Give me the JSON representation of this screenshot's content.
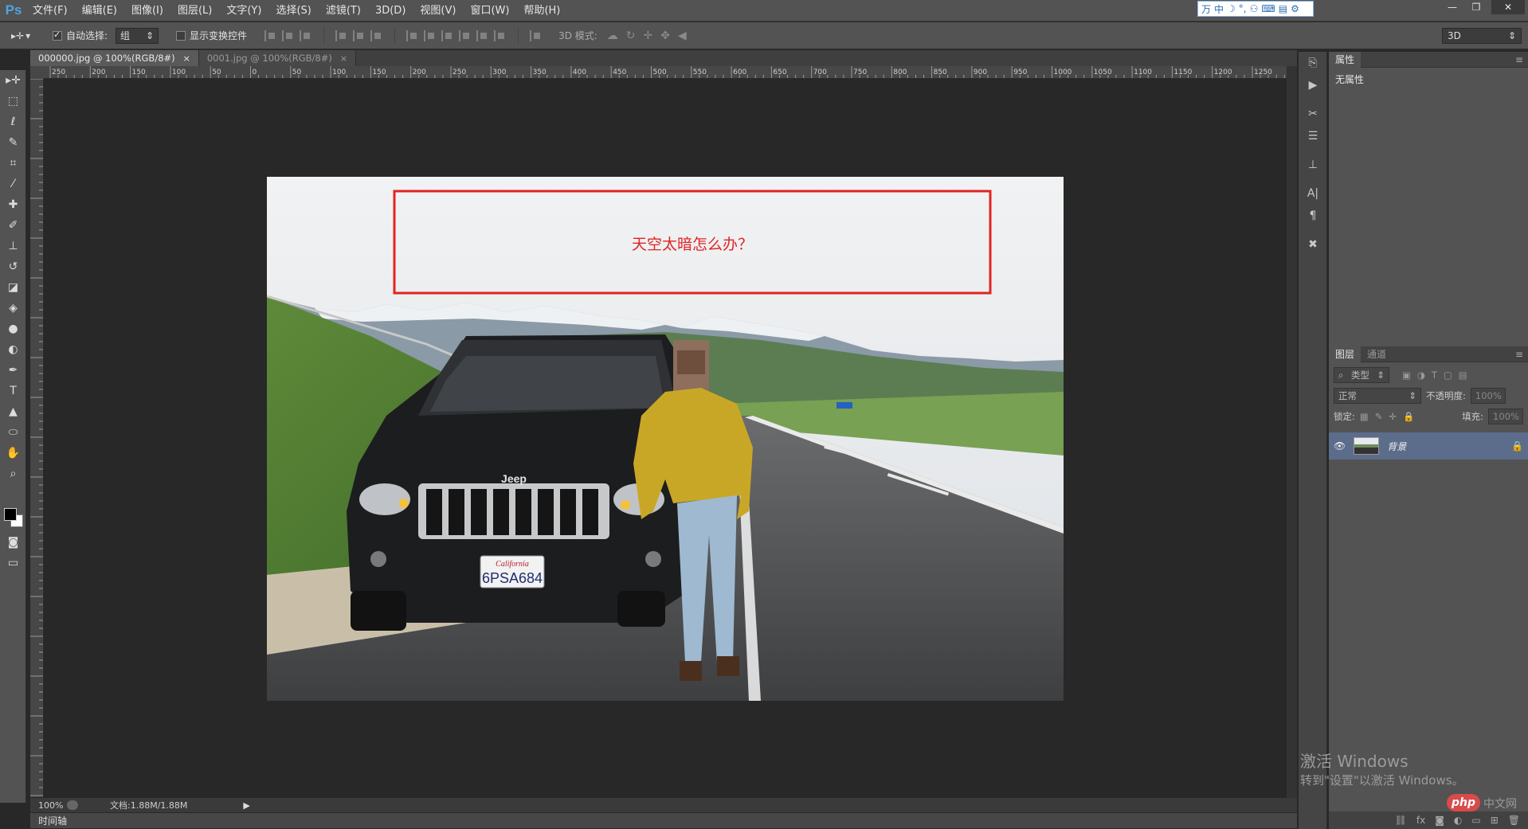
{
  "app": {
    "logo": "Ps"
  },
  "menu": [
    "文件(F)",
    "编辑(E)",
    "图像(I)",
    "图层(L)",
    "文字(Y)",
    "选择(S)",
    "滤镜(T)",
    "3D(D)",
    "视图(V)",
    "窗口(W)",
    "帮助(H)"
  ],
  "ime": {
    "label": "中"
  },
  "options": {
    "auto_select_label": "自动选择:",
    "auto_select_value": "组",
    "transform_label": "显示变换控件",
    "mode3d_label": "3D 模式:",
    "workspace": "3D"
  },
  "tabs": [
    {
      "label": "000000.jpg @ 100%(RGB/8#)",
      "close": "×"
    },
    {
      "label": "0001.jpg @ 100%(RGB/8#)",
      "close": "×"
    }
  ],
  "ruler_h": [
    "250",
    "200",
    "150",
    "100",
    "50",
    "0",
    "50",
    "100",
    "150",
    "200",
    "250",
    "300",
    "350",
    "400",
    "450",
    "500",
    "550",
    "600",
    "650",
    "700",
    "750",
    "800",
    "850",
    "900",
    "950",
    "1000",
    "1050",
    "1100",
    "1150",
    "1200",
    "1250"
  ],
  "canvas": {
    "annotation_text": "天空太暗怎么办？",
    "annotation_color": "#e02424",
    "vehicle_brand": "Jeep",
    "plate_state": "California",
    "plate_number": "6PSA684"
  },
  "status": {
    "zoom": "100%",
    "doc_info": "文档:1.88M/1.88M"
  },
  "timeline_label": "时间轴",
  "properties": {
    "tab": "属性",
    "body": "无属性"
  },
  "layers": {
    "tabs": [
      "图层",
      "通道"
    ],
    "filter_kind": "类型",
    "blend_mode": "正常",
    "opacity_label": "不透明度:",
    "opacity_value": "100%",
    "lock_label": "锁定:",
    "fill_label": "填充:",
    "fill_value": "100%",
    "layer_name": "背景"
  },
  "watermark": {
    "line1": "激活 Windows",
    "line2": "转到\"设置\"以激活 Windows。",
    "site_logo": "php",
    "site_cn": "中文网"
  }
}
